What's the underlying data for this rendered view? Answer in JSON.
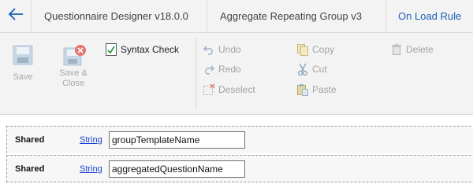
{
  "topbar": {
    "back_icon": "arrow-left-icon",
    "breadcrumbs": [
      {
        "label": "Questionnaire Designer v18.0.0"
      },
      {
        "label": "Aggregate Repeating  Group v3"
      },
      {
        "label": "On Load Rule"
      }
    ]
  },
  "ribbon": {
    "save_label": "Save",
    "save_close_label": "Save &\nClose",
    "syntax_check_label": "Syntax Check",
    "undo_label": "Undo",
    "redo_label": "Redo",
    "deselect_label": "Deselect",
    "copy_label": "Copy",
    "cut_label": "Cut",
    "paste_label": "Paste",
    "delete_label": "Delete"
  },
  "rows": [
    {
      "scope": "Shared",
      "type": "String",
      "value": "groupTemplateName"
    },
    {
      "scope": "Shared",
      "type": "String",
      "value": "aggregatedQuestionName"
    }
  ],
  "colors": {
    "accent": "#1a5fb4",
    "link": "#1a3fd1",
    "disabled": "#a7a7a7",
    "close_badge": "#e5736e"
  }
}
